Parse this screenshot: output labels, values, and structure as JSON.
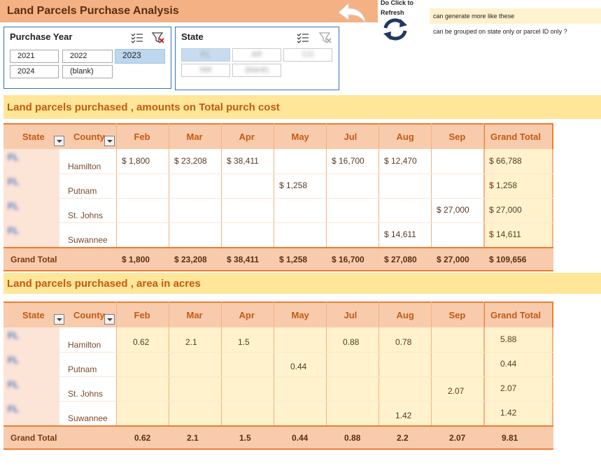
{
  "header": {
    "title": "Land Parcels Purchase Analysis",
    "refresh_label": "Do Click to Refresh",
    "note1": "can generate more like these",
    "note2": "can be grouped on state only or parcel ID only ?"
  },
  "slicer_year": {
    "title": "Purchase Year",
    "items": [
      "2021",
      "2022",
      "2023",
      "2024",
      "(blank)"
    ],
    "selected": "2023"
  },
  "slicer_state": {
    "title": "State",
    "items": [
      "FL",
      "AR",
      "CO",
      "NM",
      "(blank)"
    ],
    "selected": "FL"
  },
  "table1": {
    "section_title": "Land parcels purchased , amounts on  Total purch cost",
    "headers": [
      "State",
      "County",
      "Feb",
      "Mar",
      "Apr",
      "May",
      "Jul",
      "Aug",
      "Sep",
      "Grand Total"
    ],
    "rows": [
      {
        "state": "FL",
        "county": "Hamilton",
        "cells": [
          "$ 1,800",
          "$ 23,208",
          "$ 38,411",
          "",
          "$ 16,700",
          "$ 12,470",
          "",
          "$ 66,788"
        ]
      },
      {
        "state": "FL",
        "county": "Putnam",
        "cells": [
          "",
          "",
          "",
          "$ 1,258",
          "",
          "",
          "",
          "$ 1,258"
        ]
      },
      {
        "state": "FL",
        "county": "St. Johns",
        "cells": [
          "",
          "",
          "",
          "",
          "",
          "",
          "$ 27,000",
          "$ 27,000"
        ]
      },
      {
        "state": "FL",
        "county": "Suwannee",
        "cells": [
          "",
          "",
          "",
          "",
          "",
          "$ 14,611",
          "",
          "$ 14,611"
        ]
      }
    ],
    "grand": {
      "label": "Grand Total",
      "cells": [
        "$ 1,800",
        "$ 23,208",
        "$ 38,411",
        "$ 1,258",
        "$ 16,700",
        "$ 27,080",
        "$ 27,000",
        "$ 109,656"
      ]
    }
  },
  "table2": {
    "section_title": "Land parcels purchased , area in acres",
    "headers": [
      "State",
      "County",
      "Feb",
      "Mar",
      "Apr",
      "May",
      "Jul",
      "Aug",
      "Sep",
      "Grand Total"
    ],
    "rows": [
      {
        "state": "FL",
        "county": "Hamilton",
        "cells": [
          "0.62",
          "2.1",
          "1.5",
          "",
          "0.88",
          "0.78",
          "",
          "5.88"
        ]
      },
      {
        "state": "FL",
        "county": "Putnam",
        "cells": [
          "",
          "",
          "",
          "0.44",
          "",
          "",
          "",
          "0.44"
        ]
      },
      {
        "state": "FL",
        "county": "St. Johns",
        "cells": [
          "",
          "",
          "",
          "",
          "",
          "",
          "2.07",
          "2.07"
        ]
      },
      {
        "state": "FL",
        "county": "Suwannee",
        "cells": [
          "",
          "",
          "",
          "",
          "",
          "1.42",
          "",
          "1.42"
        ]
      }
    ],
    "grand": {
      "label": "Grand Total",
      "cells": [
        "0.62",
        "2.1",
        "1.5",
        "0.44",
        "0.88",
        "2.2",
        "2.07",
        "9.81"
      ]
    }
  },
  "colors": {
    "title_bg": "#f4b183",
    "section_bg": "#ffe699",
    "header_bg": "#f8cbad",
    "accent": "#ed7d31",
    "slicer_border": "#2e75b6",
    "slicer_selected": "#bdd7ee"
  }
}
